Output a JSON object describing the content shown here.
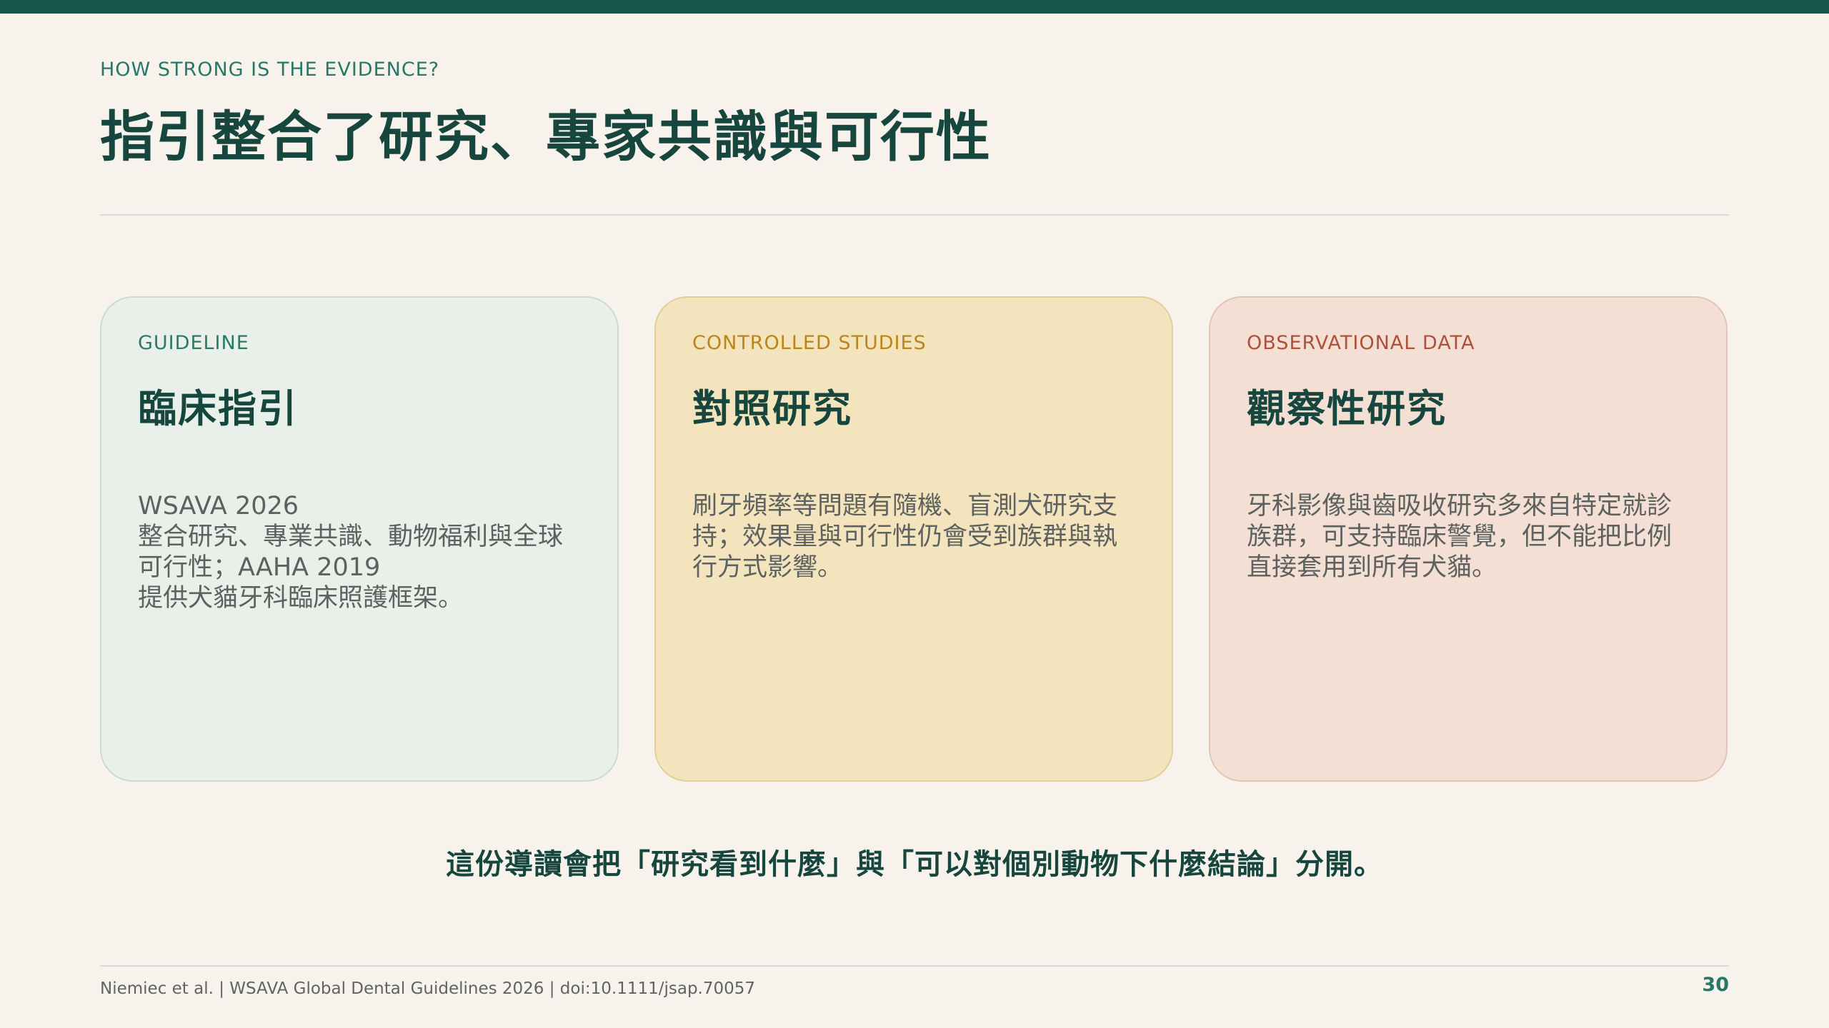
{
  "header": {
    "eyebrow": "HOW STRONG IS THE EVIDENCE?",
    "title": "指引整合了研究、專家共識與可行性"
  },
  "cards": [
    {
      "tag": "GUIDELINE",
      "title": "臨床指引",
      "body": "WSAVA 2026\n整合研究、專業共識、動物福利與全球\n可行性；AAHA 2019\n提供犬貓牙科臨床照護框架。"
    },
    {
      "tag": "CONTROLLED STUDIES",
      "title": "對照研究",
      "body": "刷牙頻率等問題有隨機、盲測犬研究支\n持；效果量與可行性仍會受到族群與執\n行方式影響。"
    },
    {
      "tag": "OBSERVATIONAL DATA",
      "title": "觀察性研究",
      "body": "牙科影像與齒吸收研究多來自特定就診\n族群，可支持臨床警覺，但不能把比例\n直接套用到所有犬貓。"
    }
  ],
  "summary": "這份導讀會把「研究看到什麼」與「可以對個別動物下什麼結論」分開。",
  "footer": {
    "citation": "Niemiec et al. | WSAVA Global Dental Guidelines 2026 | doi:10.1111/jsap.70057",
    "page_number": "30"
  },
  "colors": {
    "accent": "#17564a",
    "guideline_tag": "#2b7a68",
    "controlled_tag": "#b9861c",
    "observational_tag": "#b1503a"
  }
}
